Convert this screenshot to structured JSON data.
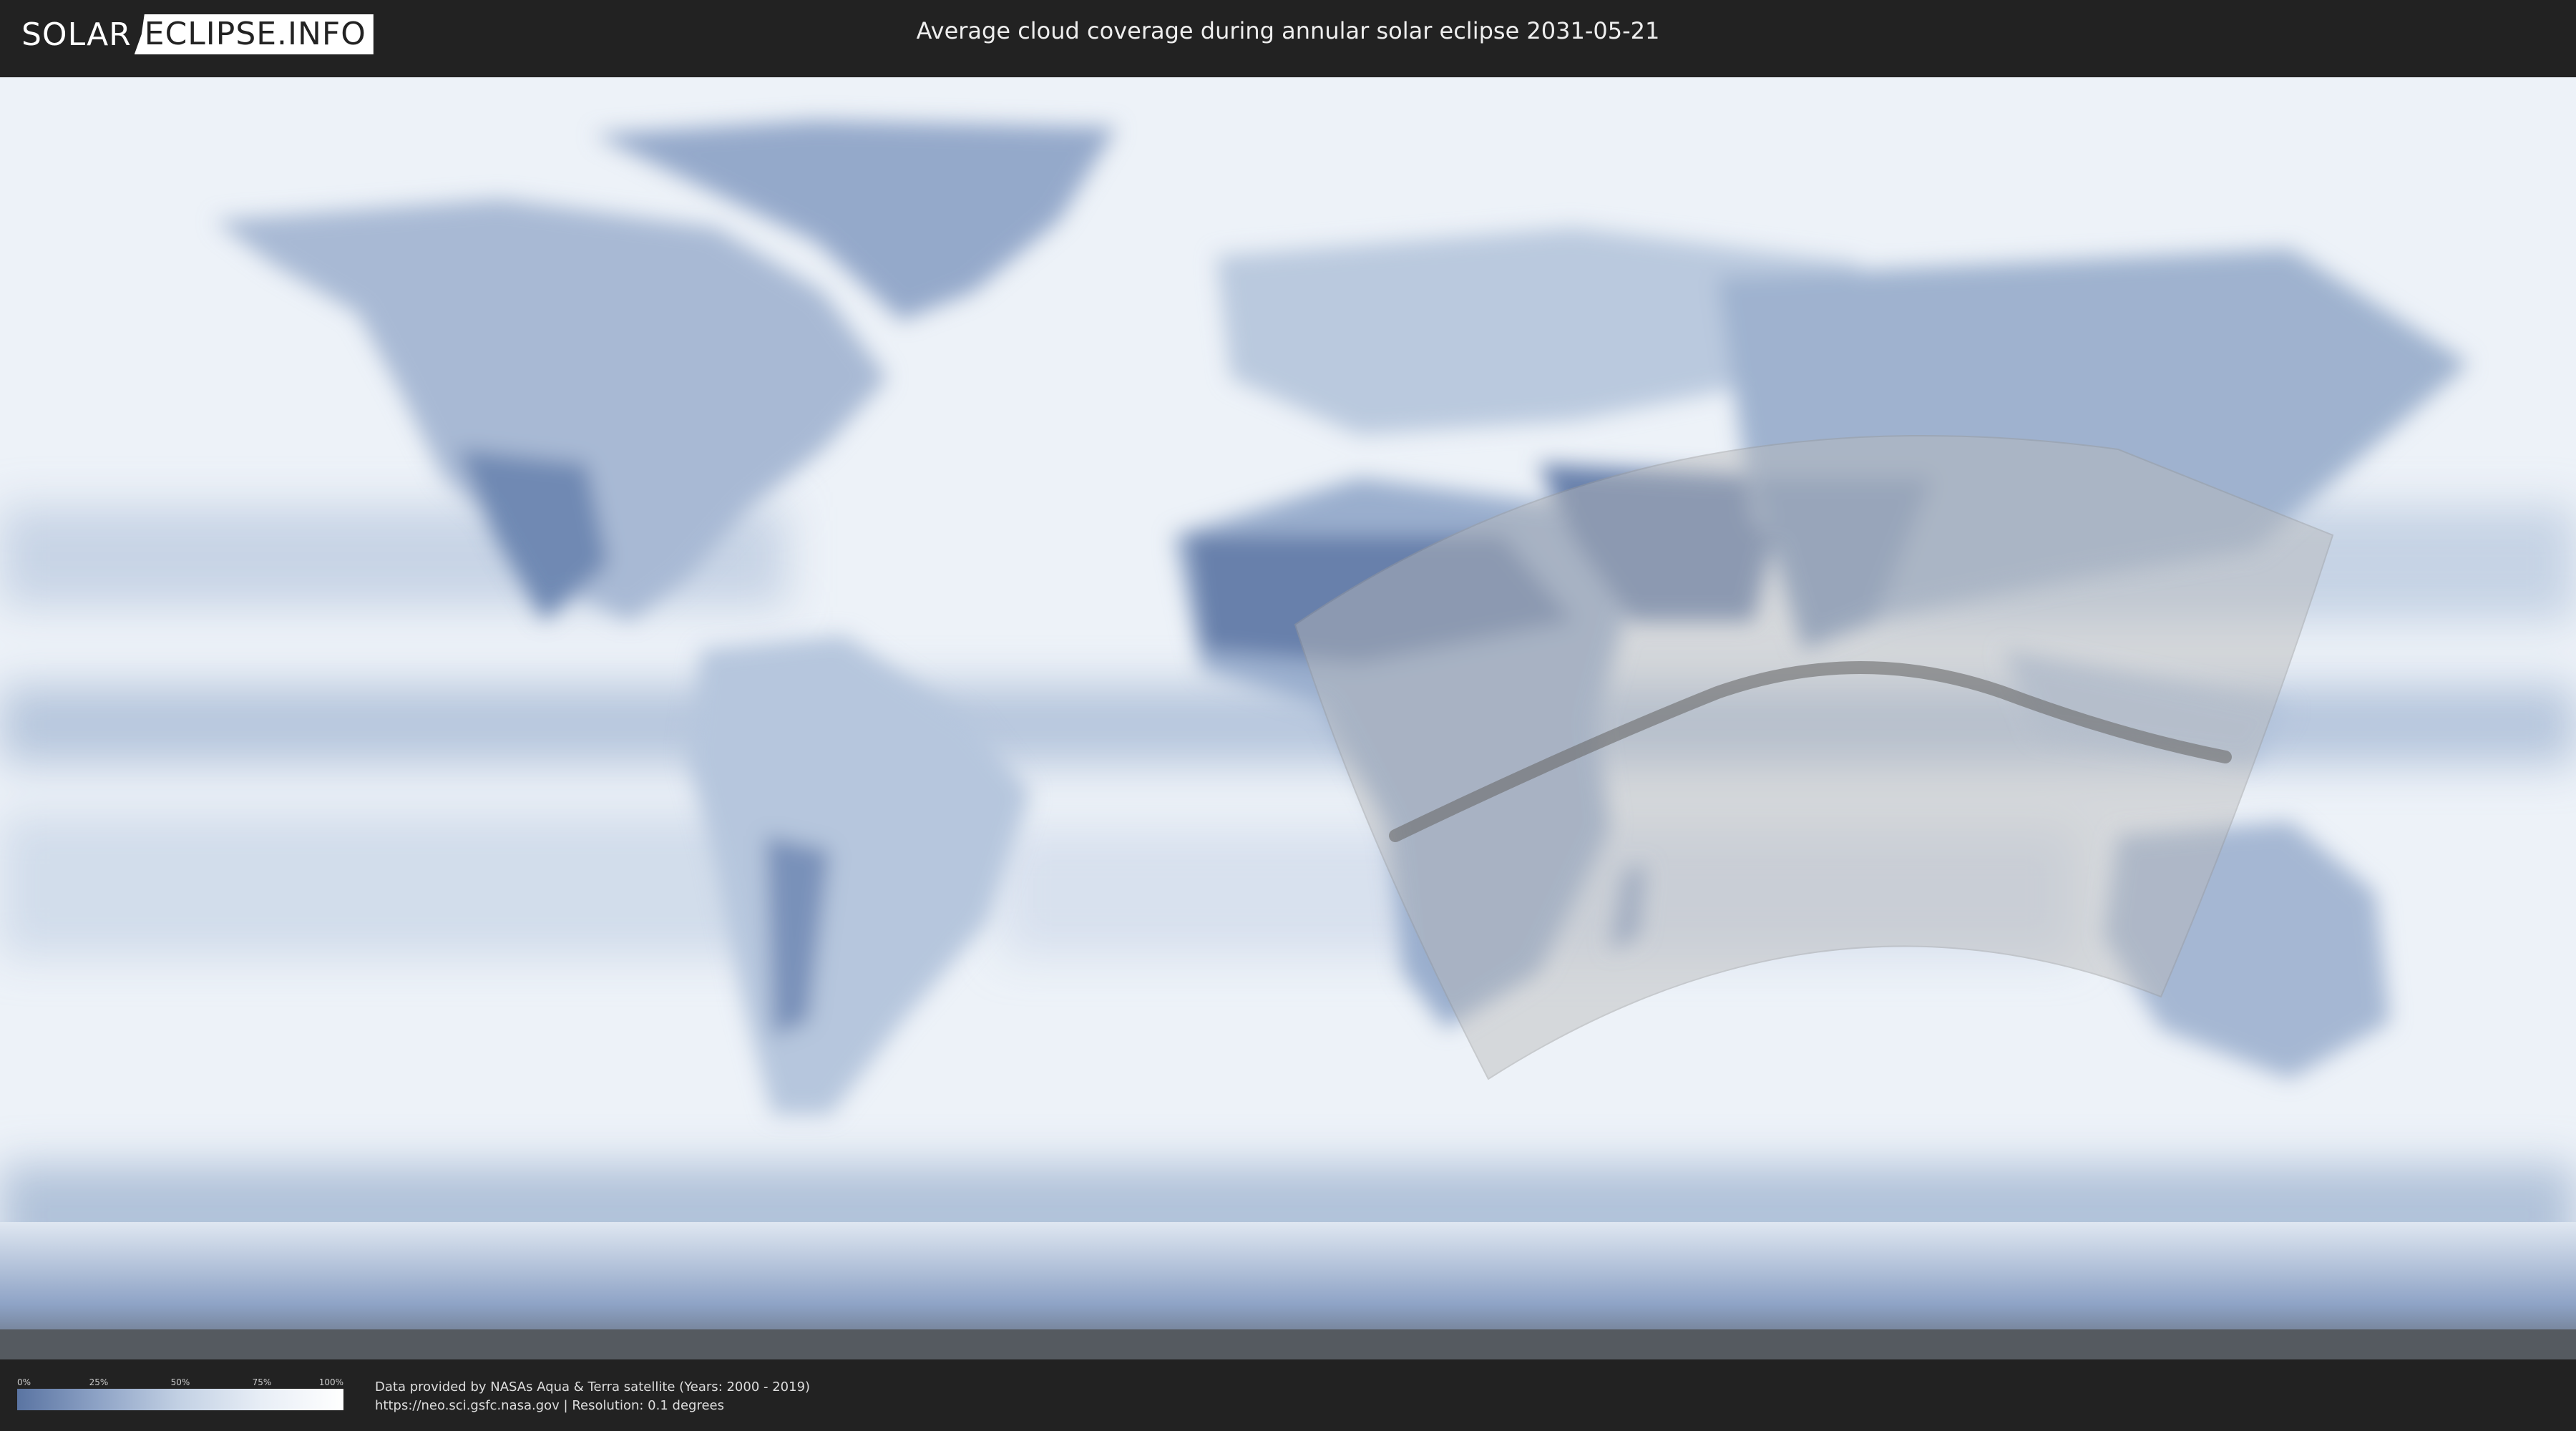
{
  "header": {
    "logo_part1": "SOLAR",
    "logo_part2": "ECLIPSE.INFO",
    "title": "Average cloud coverage during annular solar eclipse 2031-05-21"
  },
  "legend": {
    "ticks": [
      "0%",
      "25%",
      "50%",
      "75%",
      "100%"
    ],
    "colors": [
      "#5a74a2",
      "#8ea3c6",
      "#c3d1e4",
      "#e8eef6",
      "#ffffff"
    ]
  },
  "footer": {
    "line1": "Data provided by NASAs Aqua & Terra satellite (Years: 2000 - 2019)",
    "line2": "https://neo.sci.gsfc.nasa.gov | Resolution: 0.1 degrees"
  },
  "map": {
    "ocean_color": "#eaf0f6",
    "cloud_dark_color": "#6d87b1",
    "eclipse_path_color": "#6b6b6b",
    "visibility_zone_color": "#b9b9b9"
  }
}
